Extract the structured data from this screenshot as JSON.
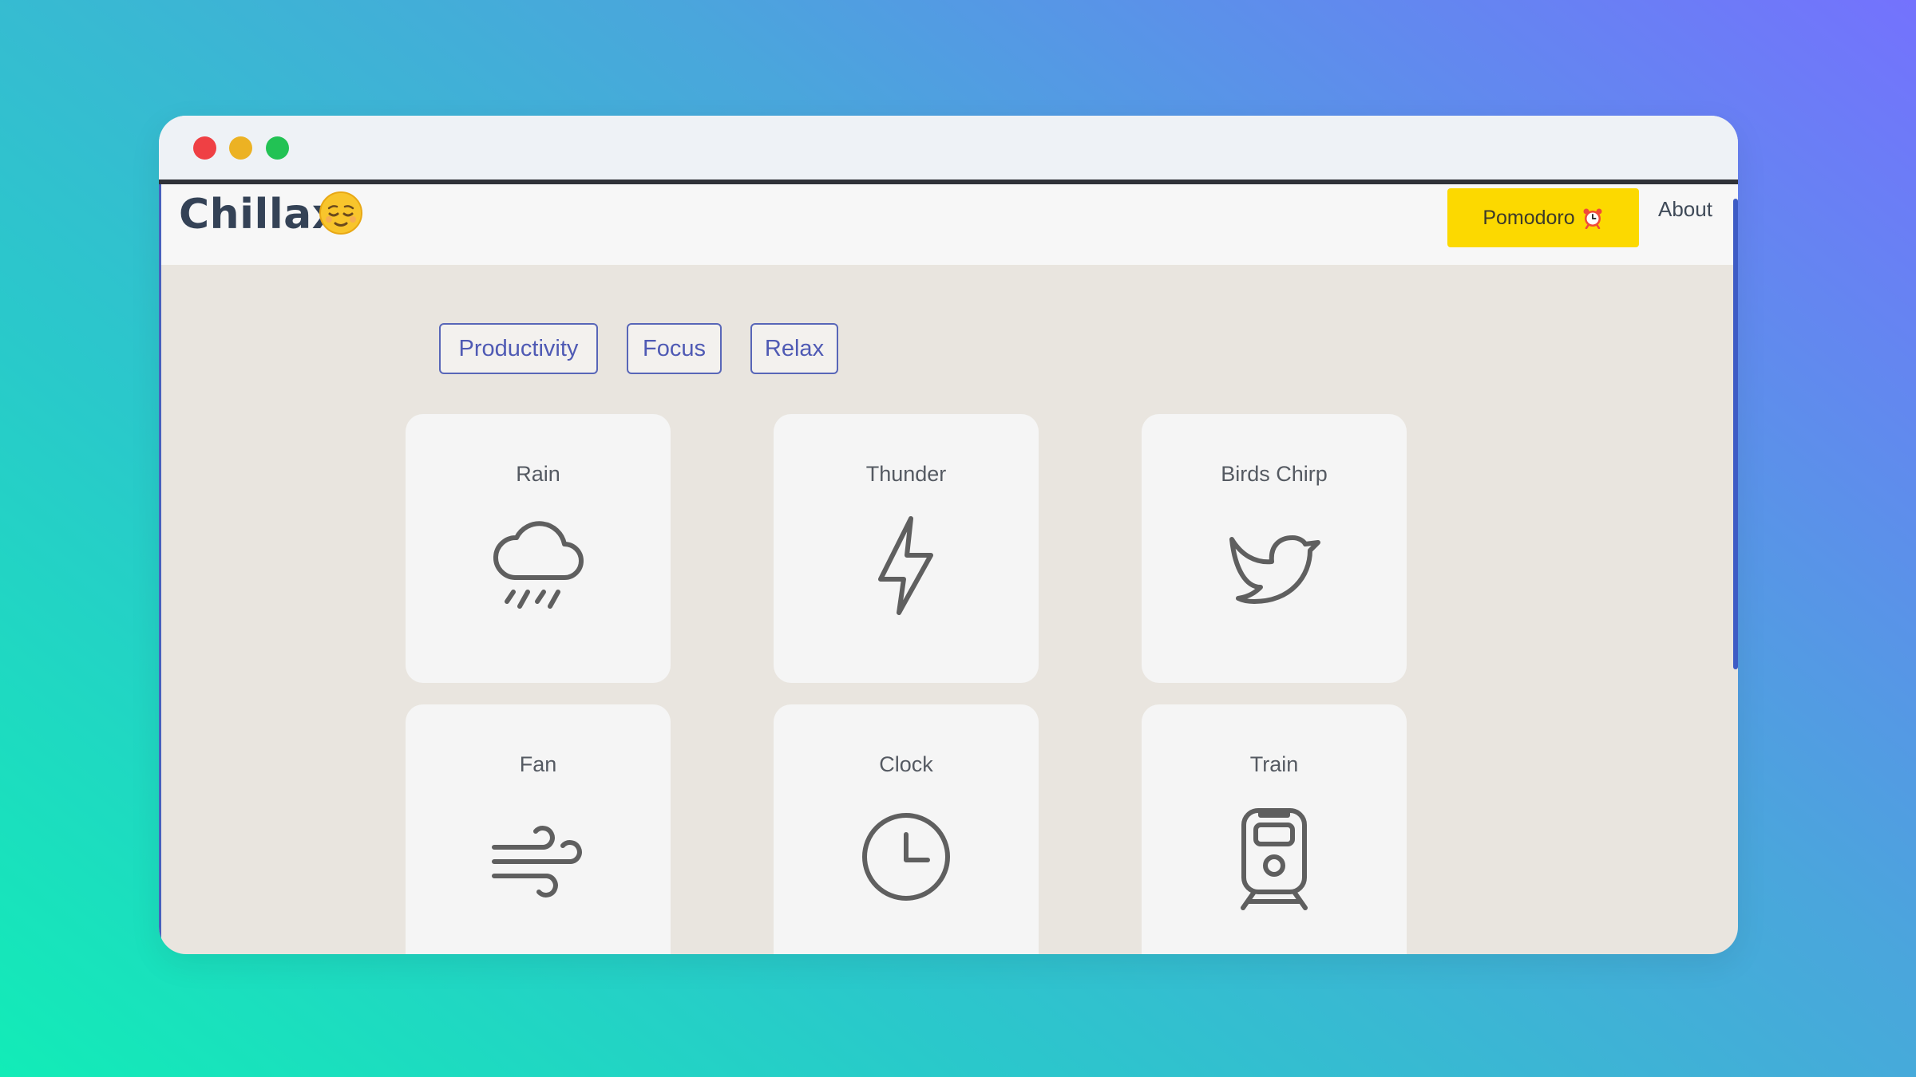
{
  "app": {
    "brand": "Chillax",
    "brand_emoji": "relieved-face-emoji"
  },
  "nav": {
    "pomodoro_label": "Pomodoro",
    "pomodoro_icon": "alarm-clock-icon",
    "about_label": "About"
  },
  "tags": [
    {
      "label": "Productivity"
    },
    {
      "label": "Focus"
    },
    {
      "label": "Relax"
    }
  ],
  "sounds": [
    {
      "label": "Rain",
      "icon": "cloud-rain-icon"
    },
    {
      "label": "Thunder",
      "icon": "lightning-bolt-icon"
    },
    {
      "label": "Birds Chirp",
      "icon": "bird-icon"
    },
    {
      "label": "Fan",
      "icon": "wind-icon"
    },
    {
      "label": "Clock",
      "icon": "clock-icon"
    },
    {
      "label": "Train",
      "icon": "train-icon"
    }
  ],
  "colors": {
    "accent_button": "#fcd900",
    "tag_border": "#5866b8",
    "brand_text": "#344256",
    "icon_stroke": "#5f5f5f"
  }
}
